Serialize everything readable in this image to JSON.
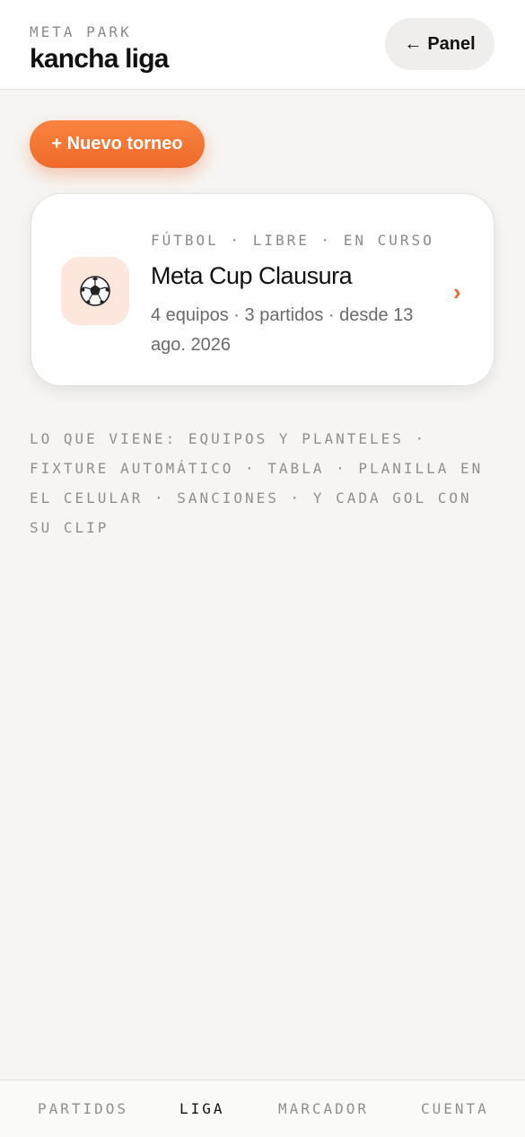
{
  "header": {
    "eyebrow": "META PARK",
    "title": "kancha liga",
    "back_arrow": "←",
    "back_label": "Panel"
  },
  "actions": {
    "new_tournament_label": "+ Nuevo torneo"
  },
  "tournament_card": {
    "icon": "⚽",
    "icon_name": "soccer-ball-icon",
    "meta": "FÚTBOL · LIBRE · EN CURSO",
    "title": "Meta Cup Clausura",
    "subtitle": "4 equipos · 3 partidos · desde 13 ago. 2026",
    "chevron": "›"
  },
  "roadmap_text": "LO QUE VIENE: EQUIPOS Y PLANTELES · FIXTURE AUTOMÁTICO · TABLA · PLANILLA EN EL CELULAR · SANCIONES · Y CADA GOL CON SU CLIP",
  "tabbar": {
    "tabs": [
      "PARTIDOS",
      "LIGA",
      "MARCADOR",
      "CUENTA"
    ],
    "active": "LIGA"
  },
  "colors": {
    "accent": "#ef6a2a",
    "background": "#f6f5f3",
    "icon_bg": "#fde6dc"
  }
}
